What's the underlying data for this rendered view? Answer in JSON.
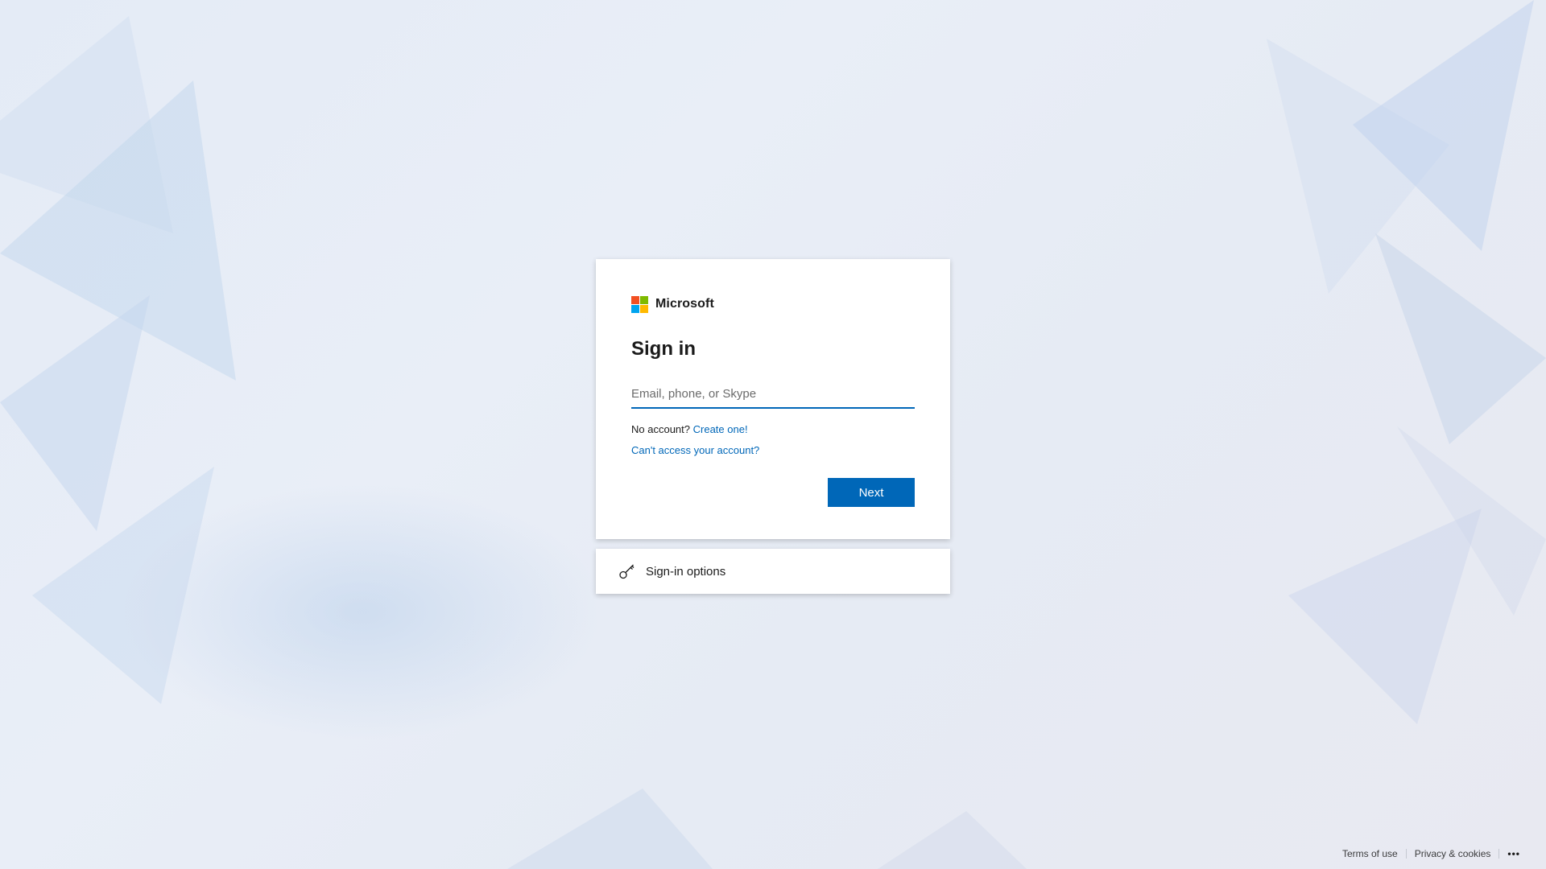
{
  "brand": {
    "name": "Microsoft",
    "logo_colors": [
      "#f25022",
      "#7fba00",
      "#00a4ef",
      "#ffb900"
    ]
  },
  "signin": {
    "title": "Sign in",
    "email_placeholder": "Email, phone, or Skype",
    "email_value": "",
    "no_account_text": "No account?",
    "create_link": "Create one!",
    "cant_access_link": "Can't access your account?",
    "next_label": "Next"
  },
  "options": {
    "label": "Sign-in options",
    "icon": "key-icon"
  },
  "footer": {
    "terms": "Terms of use",
    "privacy": "Privacy & cookies",
    "more": "•••"
  },
  "colors": {
    "accent": "#0067b8",
    "text": "#1b1b1b",
    "placeholder": "#6b6b6b"
  }
}
